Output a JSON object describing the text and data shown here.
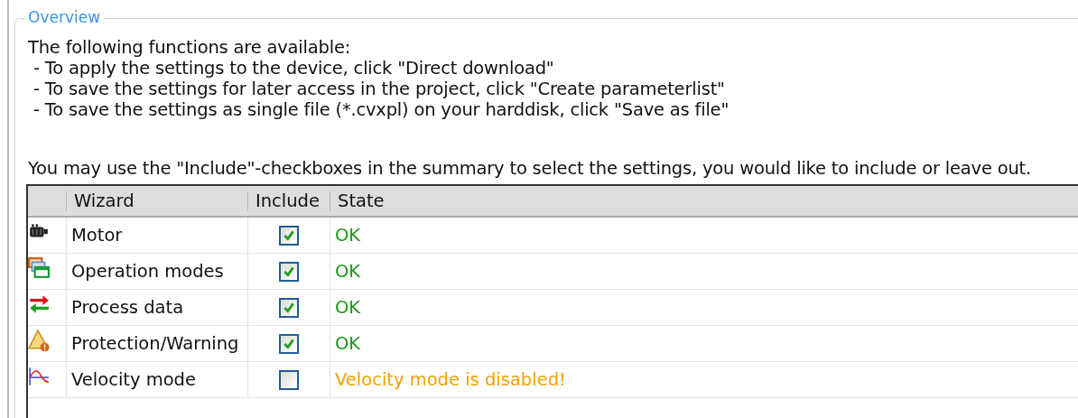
{
  "group": {
    "title": "Overview"
  },
  "intro": "The following functions are available:",
  "functions": [
    " - To apply the settings to the device, click \"Direct download\"",
    " - To save the settings for later access in the project, click \"Create parameterlist\"",
    " - To save the settings as single file (*.cvxpl) on your harddisk, click \"Save as file\""
  ],
  "hint": "You may use the \"Include\"-checkboxes in the summary to select the settings, you would like to include or leave out.",
  "table": {
    "columns": [
      "Wizard",
      "Include",
      "State"
    ],
    "rows": [
      {
        "wizard": "Motor",
        "include": true,
        "state": "OK",
        "kind": "ok"
      },
      {
        "wizard": "Operation modes",
        "include": true,
        "state": "OK",
        "kind": "ok"
      },
      {
        "wizard": "Process data",
        "include": true,
        "state": "OK",
        "kind": "ok"
      },
      {
        "wizard": "Protection/Warning",
        "include": true,
        "state": "OK",
        "kind": "ok"
      },
      {
        "wizard": "Velocity mode",
        "include": false,
        "state": "Velocity mode is disabled!",
        "kind": "disabled"
      }
    ]
  }
}
